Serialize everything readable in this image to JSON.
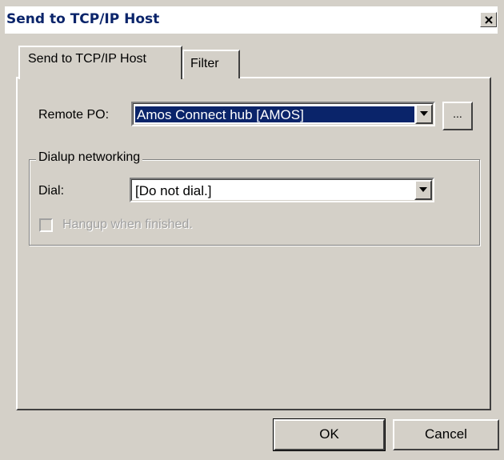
{
  "window": {
    "title": "Send to TCP/IP Host"
  },
  "tabs": [
    {
      "label": "Send to TCP/IP Host",
      "active": true
    },
    {
      "label": "Filter",
      "active": false
    }
  ],
  "remote_po": {
    "label": "Remote PO:",
    "value": "Amos Connect hub [AMOS]",
    "browse_label": "..."
  },
  "dialup": {
    "group_title": "Dialup networking",
    "dial_label": "Dial:",
    "dial_value": "[Do not dial.]",
    "hangup_label": "Hangup when finished.",
    "hangup_checked": false,
    "hangup_enabled": false
  },
  "buttons": {
    "ok": "OK",
    "cancel": "Cancel"
  },
  "colors": {
    "selection": "#0a246a",
    "face": "#d4d0c8",
    "disabled_text": "#a0a0a0"
  }
}
